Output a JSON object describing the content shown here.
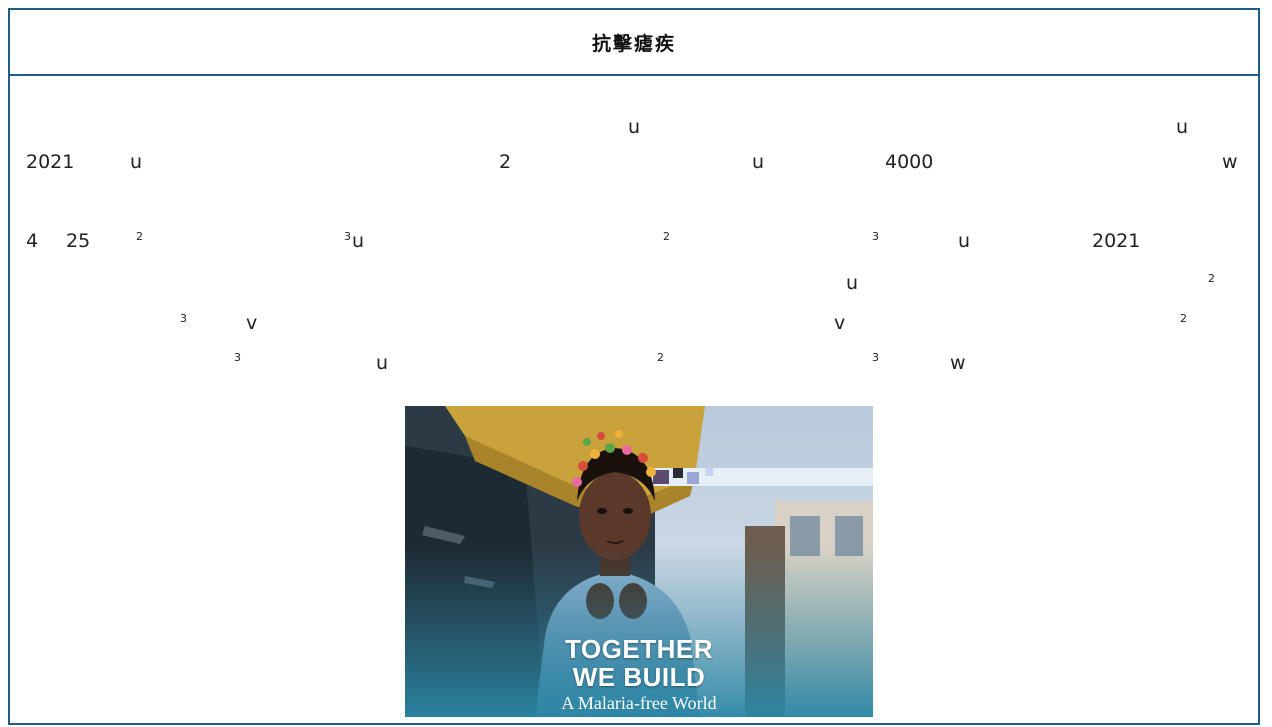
{
  "header": {
    "title": "抗擊瘧疾"
  },
  "article": {
    "fragments": [
      "u",
      "u",
      "2021",
      "u",
      "2",
      "u",
      "4000",
      "w",
      "4",
      "25",
      "2",
      "3",
      "u",
      "2",
      "3",
      "u",
      "2021",
      "u",
      "2",
      "3",
      "v",
      "v",
      "2",
      "3",
      "u",
      "2",
      "3",
      "w"
    ]
  },
  "image": {
    "caption_line1": "TOGETHER",
    "caption_line2": "WE BUILD",
    "caption_line3": "A Malaria-free World"
  },
  "colors": {
    "border": "#1f5c8a",
    "text": "#222222"
  }
}
